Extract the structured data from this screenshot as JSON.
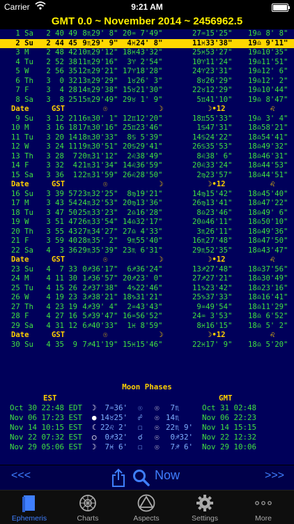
{
  "status": {
    "carrier": "Carrier",
    "time": "9:21 AM",
    "battery_pct": 100
  },
  "header": {
    "title": "GMT 0.0 ~ November 2014 ~ 2456962.5"
  },
  "table_headers": {
    "date": "Date",
    "gst": "GST",
    "sun": "☉",
    "moon": "☽",
    "mm": "☽",
    "node": "☽•12",
    "h12": "♌"
  },
  "rows": [
    {
      "type": "data",
      "date": " 1 Sa",
      "gst": " 2 40 49",
      "sun": " 8♏29' 8\"",
      "moon": "20♒ 7'49\"",
      "node": "27♒15'25\"",
      "h12": "19♎ 8' 8\""
    },
    {
      "type": "sel",
      "date": " 2 Su",
      "gst": " 2 44 45",
      "sun": " 9♏29' 9\"",
      "moon": " 4♓24' 8\"",
      "node": "11♓33'38\"",
      "h12": "19♎ 9'11\""
    },
    {
      "type": "data",
      "date": " 3 M ",
      "gst": " 2 48 42",
      "sun": "10♏29'12\"",
      "moon": "18♓43'32\"",
      "node": "25♓53'27\"",
      "h12": "19♎10'35\""
    },
    {
      "type": "data",
      "date": " 4 Tu",
      "gst": " 2 52 38",
      "sun": "11♏29'16\"",
      "moon": " 3♈ 2'54\"",
      "node": "10♈11'24\"",
      "h12": "19♎11'51\""
    },
    {
      "type": "data",
      "date": " 5 W ",
      "gst": " 2 56 35",
      "sun": "12♏29'21\"",
      "moon": "17♈18'28\"",
      "node": "24♈23'31\"",
      "h12": "19♎12' 6\""
    },
    {
      "type": "data",
      "date": " 6 Th",
      "gst": " 3  0 32",
      "sun": "13♏29'29\"",
      "moon": " 1♉26' 3\"",
      "node": " 8♉26'29\"",
      "h12": "19♎12' 2\""
    },
    {
      "type": "data",
      "date": " 7 F ",
      "gst": " 3  4 28",
      "sun": "14♏29'38\"",
      "moon": "15♉21'30\"",
      "node": "22♉12'29\"",
      "h12": "19♎10'44\""
    },
    {
      "type": "data",
      "date": " 8 Sa",
      "gst": " 3  8 25",
      "sun": "15♏29'49\"",
      "moon": "29♉ 1' 9\"",
      "node": " 5♊41'10\"",
      "h12": "19♎ 8'47\""
    },
    {
      "type": "hdr",
      "date": "Date",
      "gst": "GST",
      "sun": "☉",
      "moon": "☽",
      "mm": "☽",
      "node": "☽•12",
      "h12": "♌"
    },
    {
      "type": "data",
      "date": " 9 Su",
      "gst": " 3 12 21",
      "sun": "16♏30' 1\"",
      "moon": "12♊12'20\"",
      "node": "18♊55'33\"",
      "h12": "19♎ 3' 4\""
    },
    {
      "type": "data",
      "date": "10 M ",
      "gst": " 3 16 18",
      "sun": "17♏30'16\"",
      "moon": "25♊23'46\"",
      "node": " 1♋47'31\"",
      "h12": "18♎58'21\""
    },
    {
      "type": "data",
      "date": "11 Tu",
      "gst": " 3 20 14",
      "sun": "18♏30'33\"",
      "moon": " 8♋ 5'39\"",
      "node": "14♋24'22\"",
      "h12": "18♎54'41\""
    },
    {
      "type": "data",
      "date": "12 W ",
      "gst": " 3 24 11",
      "sun": "19♏30'51\"",
      "moon": "20♋29'41\"",
      "node": "26♋35'53\"",
      "h12": "18♎49'32\""
    },
    {
      "type": "data",
      "date": "13 Th",
      "gst": " 3 28  7",
      "sun": "20♏31'12\"",
      "moon": " 2♌38'49\"",
      "node": " 8♌38' 6\"",
      "h12": "18♎46'31\""
    },
    {
      "type": "data",
      "date": "14 F ",
      "gst": " 3 32  4",
      "sun": "21♏31'34\"",
      "moon": "14♌36'59\"",
      "node": "20♌33'24\"",
      "h12": "18♎44'53\""
    },
    {
      "type": "data",
      "date": "15 Sa",
      "gst": " 3 36  1",
      "sun": "22♏31'59\"",
      "moon": "26♌28'50\"",
      "node": " 2♍23'57\"",
      "h12": "18♎44'51\""
    },
    {
      "type": "hdr",
      "date": "Date",
      "gst": "GST",
      "sun": "☉",
      "moon": "☽",
      "mm": "☽",
      "node": "☽•12",
      "h12": "♌"
    },
    {
      "type": "data",
      "date": "16 Su",
      "gst": " 3 39 57",
      "sun": "23♏32'25\"",
      "moon": " 8♍19'21\"",
      "node": "14♍15'42\"",
      "h12": "18♎45'40\""
    },
    {
      "type": "data",
      "date": "17 M ",
      "gst": " 3 43 54",
      "sun": "24♏32'53\"",
      "moon": "20♍13'36\"",
      "node": "26♍13'41\"",
      "h12": "18♎47'22\""
    },
    {
      "type": "data",
      "date": "18 Tu",
      "gst": " 3 47 50",
      "sun": "25♏33'23\"",
      "moon": " 2♎16'28\"",
      "node": " 8♎23'46\"",
      "h12": "18♎49' 6\""
    },
    {
      "type": "data",
      "date": "19 W ",
      "gst": " 3 51 47",
      "sun": "26♏33'54\"",
      "moon": "14♎32'17\"",
      "node": "20♎46'11\"",
      "h12": "18♎50'10\""
    },
    {
      "type": "data",
      "date": "20 Th",
      "gst": " 3 55 43",
      "sun": "27♏34'27\"",
      "moon": "27♎ 4'33\"",
      "node": " 3♏26'11\"",
      "h12": "18♎49'36\""
    },
    {
      "type": "data",
      "date": "21 F ",
      "gst": " 3 59 40",
      "sun": "28♏35' 2\"",
      "moon": " 9♏55'40\"",
      "node": "16♏27'48\"",
      "h12": "18♎47'50\""
    },
    {
      "type": "data",
      "date": "22 Sa",
      "gst": " 4  3 36",
      "sun": "29♏35'39\"",
      "moon": "23♏ 6'31\"",
      "node": "29♏52'35\"",
      "h12": "18♎43'47\""
    },
    {
      "type": "hdr",
      "date": "Date",
      "gst": "GST",
      "sun": "☉",
      "moon": "☽",
      "mm": "☽",
      "node": "☽•12",
      "h12": "♌"
    },
    {
      "type": "data",
      "date": "23 Su",
      "gst": " 4  7 33",
      "sun": " 0♐36'17\"",
      "moon": " 6♐36'24\"",
      "node": "13♐27'48\"",
      "h12": "18♎37'56\""
    },
    {
      "type": "data",
      "date": "24 M ",
      "gst": " 4 11 30",
      "sun": " 1♐36'57\"",
      "moon": "20♐23' 0\"",
      "node": "27♐27'21\"",
      "h12": "18♎30'49\""
    },
    {
      "type": "data",
      "date": "25 Tu",
      "gst": " 4 15 26",
      "sun": " 2♐37'38\"",
      "moon": " 4♑22'46\"",
      "node": "11♑23'42\"",
      "h12": "18♎23'16\""
    },
    {
      "type": "data",
      "date": "26 W ",
      "gst": " 4 19 23",
      "sun": " 3♐38'21\"",
      "moon": "18♑31'21\"",
      "node": "25♑37'33\"",
      "h12": "18♎16'41\""
    },
    {
      "type": "data",
      "date": "27 Th",
      "gst": " 4 23 19",
      "sun": " 4♐39' 4\"",
      "moon": " 2♒43'43\"",
      "node": " 9♒49'54\"",
      "h12": "18♎11'29\""
    },
    {
      "type": "data",
      "date": "28 F ",
      "gst": " 4 27 16",
      "sun": " 5♐39'47\"",
      "moon": "16♒56'52\"",
      "node": "24♒ 3'53\"",
      "h12": "18♎ 6'52\""
    },
    {
      "type": "data",
      "date": "29 Sa",
      "gst": " 4 31 12",
      "sun": " 6♐40'33\"",
      "moon": " 1♓ 8'59\"",
      "node": " 8♓16'15\"",
      "h12": "18♎ 5' 2\""
    },
    {
      "type": "hdr",
      "date": "Date",
      "gst": "GST",
      "sun": "☉",
      "moon": "☽",
      "mm": "☽",
      "node": "☽•12",
      "h12": "♌"
    },
    {
      "type": "data",
      "date": "30 Su",
      "gst": " 4 35  9",
      "sun": " 7♐41'19\"",
      "moon": "15♓15'46\"",
      "node": "22♓17' 9\"",
      "h12": "18♎ 5'20\""
    }
  ],
  "moon_phases": {
    "title": "Moon Phases",
    "est_label": "EST",
    "gmt_label": "GMT",
    "rows": [
      {
        "est": "Oct 30 22:48 EDT",
        "p1": "☽",
        "p1v": " 7♒36'",
        "p2": "☉",
        "p3": "☉",
        "p3v": " 7♏",
        "gmt": "Oct 31 02:48"
      },
      {
        "est": "Nov 06 17:23 EST",
        "p1": "●",
        "p1v": "14♉25'",
        "p2": "☍",
        "p3": "☉",
        "p3v": "14♏",
        "gmt": "Nov 06 22:23"
      },
      {
        "est": "Nov 14 10:15 EST",
        "p1": "☾",
        "p1v": "22♌ 2'",
        "p2": "☐",
        "p3": "☉",
        "p3v": "22♏ 9'",
        "gmt": "Nov 14 15:15"
      },
      {
        "est": "Nov 22 07:32 EST",
        "p1": "○",
        "p1v": " 0♐32'",
        "p2": "☌",
        "p3": "☉",
        "p3v": " 0♐32'",
        "gmt": "Nov 22 12:32"
      },
      {
        "est": "Nov 29 05:06 EST",
        "p1": "☽",
        "p1v": " 7♓ 6'",
        "p2": "☐",
        "p3": "☉",
        "p3v": " 7♐ 6'",
        "gmt": "Nov 29 10:06"
      }
    ]
  },
  "toolbar": {
    "prev": "<<<",
    "next": ">>>",
    "now": "Now"
  },
  "tabs": [
    {
      "label": "Ephemeris",
      "active": true
    },
    {
      "label": "Charts",
      "active": false
    },
    {
      "label": "Aspects",
      "active": false
    },
    {
      "label": "Settings",
      "active": false
    },
    {
      "label": "More",
      "active": false
    }
  ]
}
